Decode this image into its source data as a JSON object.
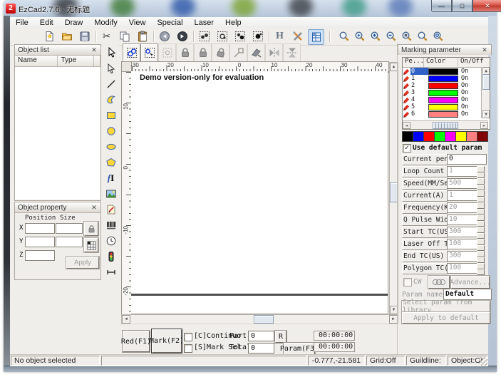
{
  "window": {
    "title": "EzCad2.7.6 - 无标题",
    "controls": {
      "minimize": "—",
      "maximize": "□",
      "close": "✕"
    }
  },
  "menu": {
    "items": [
      "File",
      "Edit",
      "Draw",
      "Modify",
      "View",
      "Special",
      "Laser",
      "Help"
    ]
  },
  "object_list": {
    "title": "Object list",
    "columns": [
      "Name",
      "Type"
    ]
  },
  "object_property": {
    "title": "Object property",
    "headers": [
      "Position",
      "Size"
    ],
    "axes": [
      "X",
      "Y",
      "Z"
    ],
    "apply_label": "Apply"
  },
  "canvas": {
    "demo_text": "Demo version-only for evaluation",
    "h_labels": [
      "-30",
      "-20",
      "-10",
      "0",
      "10",
      "20",
      "30",
      "40"
    ],
    "v_labels": [
      "10",
      "0",
      "-10",
      "-20"
    ]
  },
  "marking": {
    "title": "Marking parameter",
    "table": {
      "columns": [
        "Pe...",
        "Color",
        "On/Off"
      ],
      "pens": [
        {
          "id": "0",
          "color": "#000000",
          "state": "On"
        },
        {
          "id": "1",
          "color": "#0000ff",
          "state": "On"
        },
        {
          "id": "2",
          "color": "#ff0000",
          "state": "On"
        },
        {
          "id": "3",
          "color": "#00ff00",
          "state": "On"
        },
        {
          "id": "4",
          "color": "#ff00ff",
          "state": "On"
        },
        {
          "id": "5",
          "color": "#ffff00",
          "state": "On"
        },
        {
          "id": "6",
          "color": "#ff8080",
          "state": "On"
        }
      ]
    },
    "palette": [
      "#000000",
      "#0000ff",
      "#ff0000",
      "#00ff00",
      "#ff00ff",
      "#ffff00",
      "#ff8080",
      "#800000"
    ],
    "use_default_label": "Use default param",
    "params": [
      {
        "label": "Current pen",
        "value": "0"
      },
      {
        "label": "Loop Count",
        "value": "1"
      },
      {
        "label": "Speed(MM/Second",
        "value": "500"
      },
      {
        "label": "Current(A)",
        "value": "1"
      },
      {
        "label": "Frequency(KHz)",
        "value": "20"
      },
      {
        "label": "Q Pulse Width(U",
        "value": "10"
      },
      {
        "label": "Start TC(US)",
        "value": "300"
      },
      {
        "label": "Laser Off TC(US",
        "value": "100"
      },
      {
        "label": "End TC(US)",
        "value": "300"
      },
      {
        "label": "Polygon TC(US)",
        "value": "100"
      }
    ],
    "cw_label": "CW",
    "advance_label": "Advance...",
    "param_name_label": "Param name",
    "param_name_value": "Default",
    "select_library_label": "Select param from library",
    "apply_default_label": "Apply to default"
  },
  "bottom": {
    "red_label": "Red(F1)",
    "mark_label": "Mark(F2)",
    "continuous_label": "[C]Continuo",
    "part_label": "Part",
    "part_value": "0",
    "r_label": "R",
    "mark_sel_label": "[S]Mark Sel",
    "total_label": "Total",
    "total_value": "0",
    "param_label": "Param(F3)",
    "timer_top": "00:00:00",
    "timer_bottom": "00:00:00"
  },
  "status": {
    "message": "No object selected",
    "coords": "-0.777,-21.581",
    "grid": "Grid:Off",
    "guildline": "Guildline:",
    "object": "Object:Of"
  }
}
